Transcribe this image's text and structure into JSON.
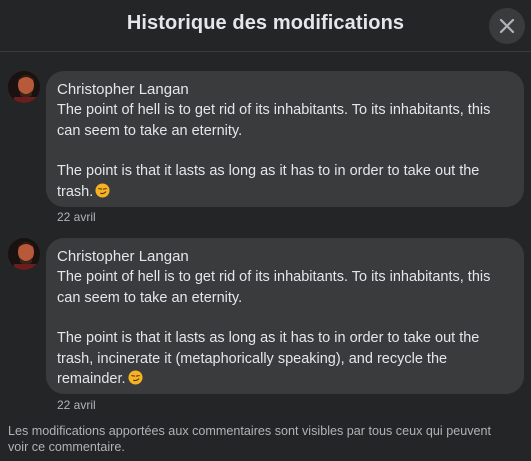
{
  "dialog": {
    "title": "Historique des modifications",
    "close_label": "Fermer"
  },
  "entries": [
    {
      "author": "Christopher Langan",
      "paragraphs": [
        "The point of hell is to get rid of its inhabitants. To its inhabitants, this can seem to take an eternity.",
        "The point is that it lasts as long as it has to in order to take out the trash."
      ],
      "emoji": "smirk-emoji",
      "date": "22 avril"
    },
    {
      "author": "Christopher Langan",
      "paragraphs": [
        "The point of hell is to get rid of its inhabitants. To its inhabitants, this can seem to take an eternity.",
        "The point is that it lasts as long as it has to in order to take out the trash, incinerate it (metaphorically speaking), and recycle the remainder."
      ],
      "emoji": "smirk-emoji",
      "date": "22 avril"
    }
  ],
  "footer": {
    "note": "Les modifications apportées aux commentaires sont visibles par tous ceux qui peuvent voir ce commentaire."
  },
  "colors": {
    "background": "#242526",
    "bubble": "#3a3b3c",
    "primary_text": "#e4e6eb",
    "secondary_text": "#b0b3b8"
  }
}
